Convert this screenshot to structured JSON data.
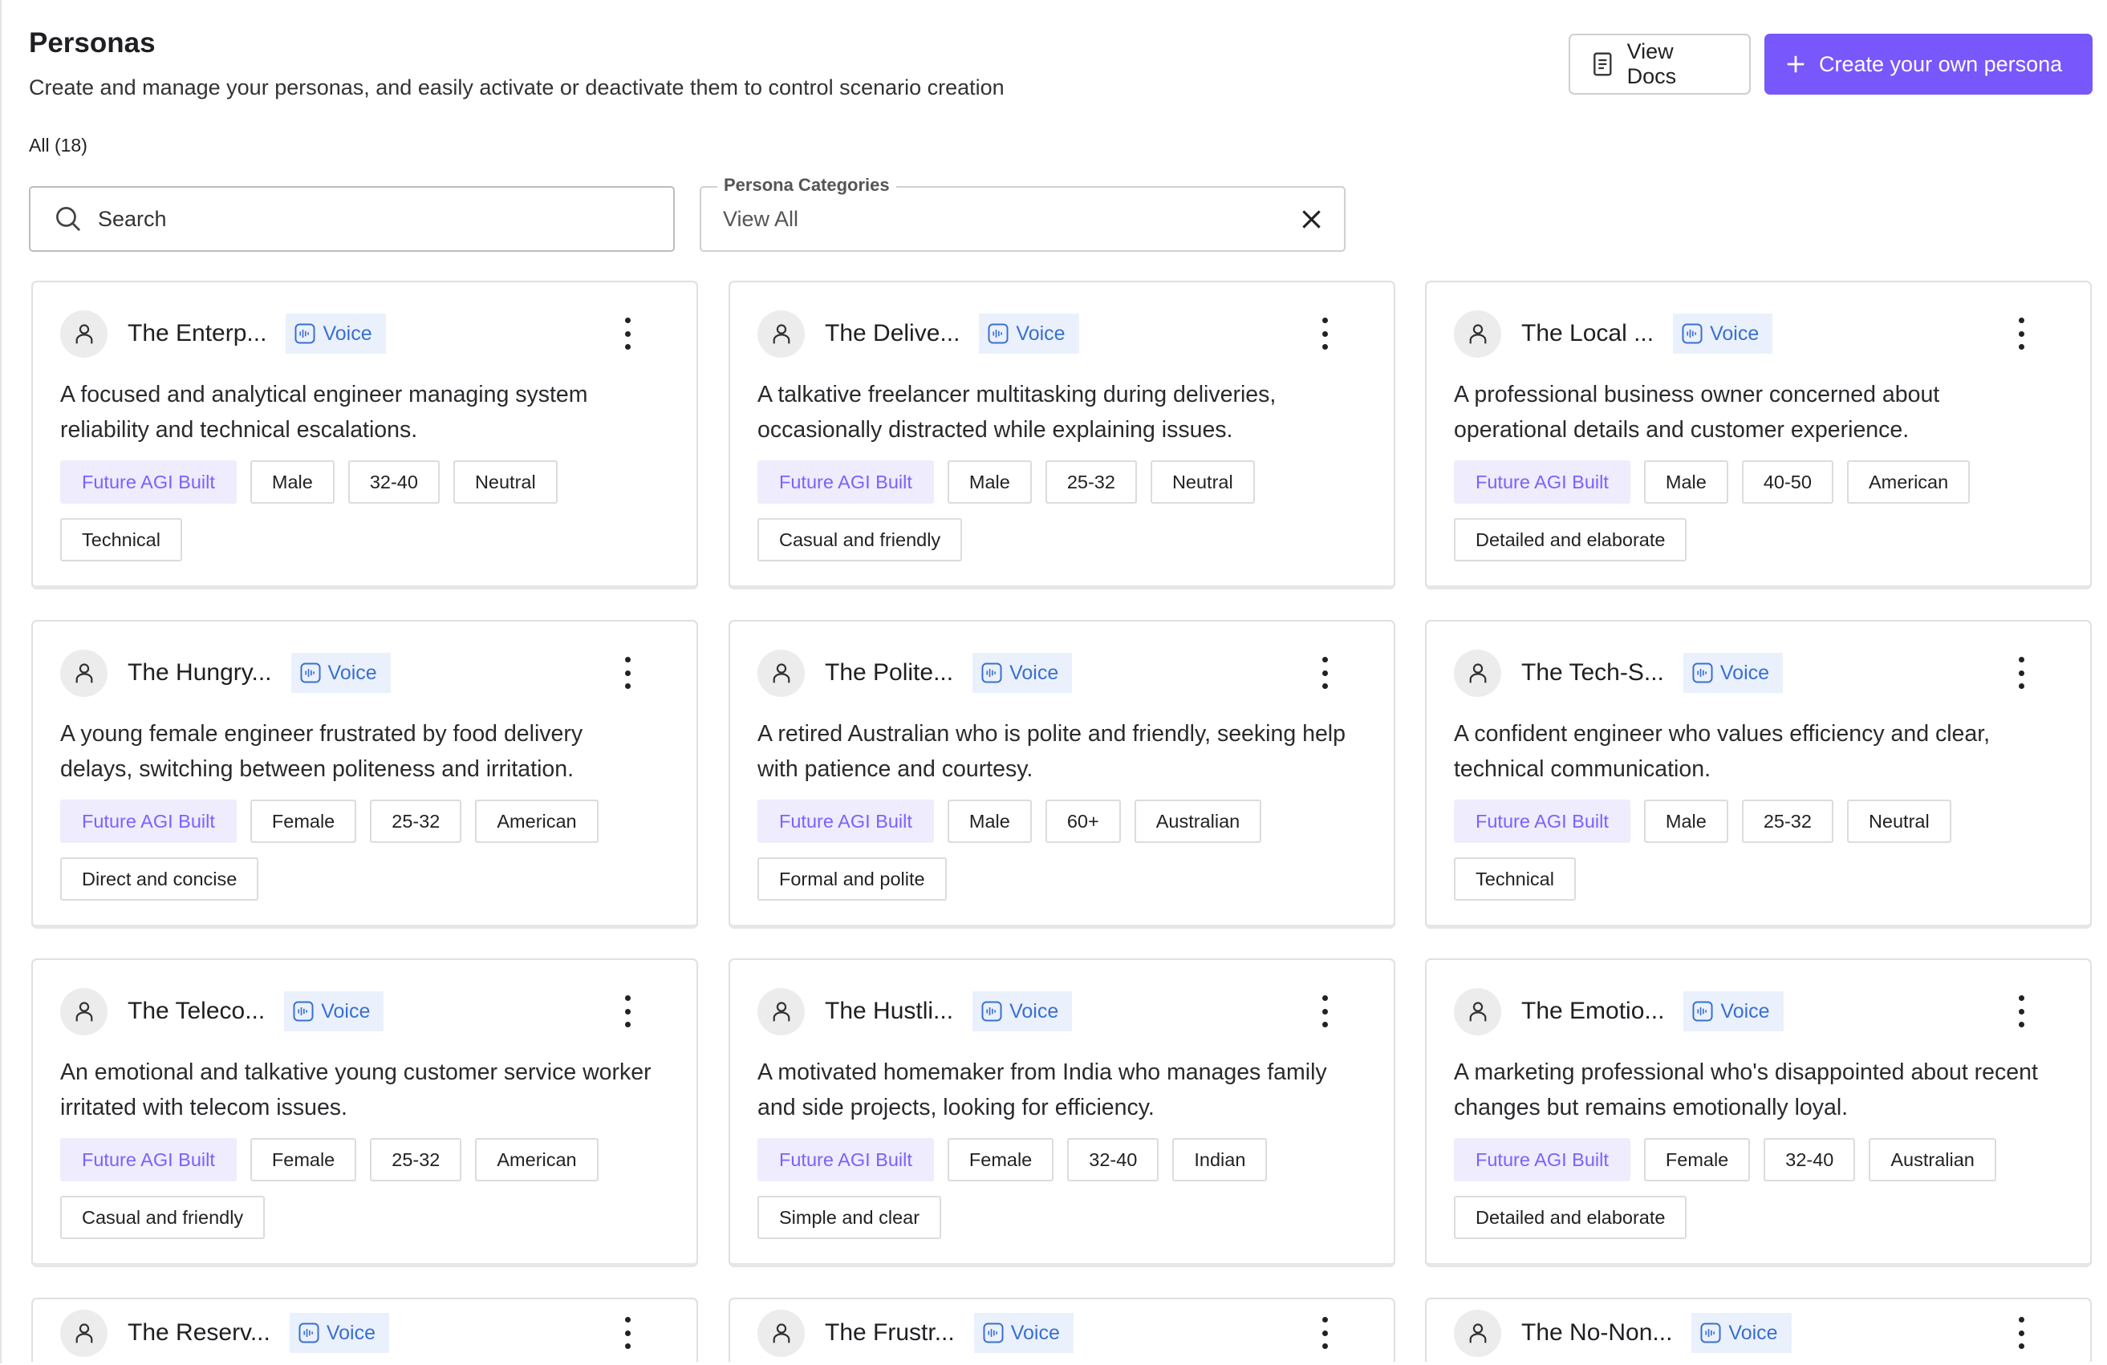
{
  "header": {
    "title": "Personas",
    "subtitle": "Create and manage your personas, and easily activate or deactivate them to control scenario creation",
    "count_label": "All (18)"
  },
  "actions": {
    "view_docs": "View Docs",
    "create": "Create your own persona"
  },
  "search": {
    "placeholder": "Search"
  },
  "category_filter": {
    "label": "Persona Categories",
    "value": "View All"
  },
  "colors": {
    "primary": "#7857fc",
    "voice_bg": "#eaf1fd",
    "voice_text": "#3a6fd0",
    "agi_bg": "#efecfd",
    "agi_text": "#7b61ff"
  },
  "personas": [
    {
      "name": "The Enterp...",
      "badge": "Voice",
      "description": "A focused and analytical engineer managing system reliability and technical escalations.",
      "tags": [
        "Future AGI Built",
        "Male",
        "32-40",
        "Neutral",
        "Technical"
      ]
    },
    {
      "name": "The Delive...",
      "badge": "Voice",
      "description": "A talkative freelancer multitasking during deliveries, occasionally distracted while explaining issues.",
      "tags": [
        "Future AGI Built",
        "Male",
        "25-32",
        "Neutral",
        "Casual and friendly"
      ]
    },
    {
      "name": "The Local ...",
      "badge": "Voice",
      "description": "A professional business owner concerned about operational details and customer experience.",
      "tags": [
        "Future AGI Built",
        "Male",
        "40-50",
        "American",
        "Detailed and elaborate"
      ]
    },
    {
      "name": "The Hungry...",
      "badge": "Voice",
      "description": "A young female engineer frustrated by food delivery delays, switching between politeness and irritation.",
      "tags": [
        "Future AGI Built",
        "Female",
        "25-32",
        "American",
        "Direct and concise"
      ]
    },
    {
      "name": "The Polite...",
      "badge": "Voice",
      "description": "A retired Australian who is polite and friendly, seeking help with patience and courtesy.",
      "tags": [
        "Future AGI Built",
        "Male",
        "60+",
        "Australian",
        "Formal and polite"
      ]
    },
    {
      "name": "The Tech-S...",
      "badge": "Voice",
      "description": "A confident engineer who values efficiency and clear, technical communication.",
      "tags": [
        "Future AGI Built",
        "Male",
        "25-32",
        "Neutral",
        "Technical"
      ]
    },
    {
      "name": "The Teleco...",
      "badge": "Voice",
      "description": "An emotional and talkative young customer service worker irritated with telecom issues.",
      "tags": [
        "Future AGI Built",
        "Female",
        "25-32",
        "American",
        "Casual and friendly"
      ]
    },
    {
      "name": "The Hustli...",
      "badge": "Voice",
      "description": "A motivated homemaker from India who manages family and side projects, looking for efficiency.",
      "tags": [
        "Future AGI Built",
        "Female",
        "32-40",
        "Indian",
        "Simple and clear"
      ]
    },
    {
      "name": "The Emotio...",
      "badge": "Voice",
      "description": "A marketing professional who's disappointed about recent changes but remains emotionally loyal.",
      "tags": [
        "Future AGI Built",
        "Female",
        "32-40",
        "Australian",
        "Detailed and elaborate"
      ]
    },
    {
      "name": "The Reserv...",
      "badge": "Voice",
      "description": "",
      "tags": []
    },
    {
      "name": "The Frustr...",
      "badge": "Voice",
      "description": "",
      "tags": []
    },
    {
      "name": "The No-Non...",
      "badge": "Voice",
      "description": "",
      "tags": []
    }
  ]
}
